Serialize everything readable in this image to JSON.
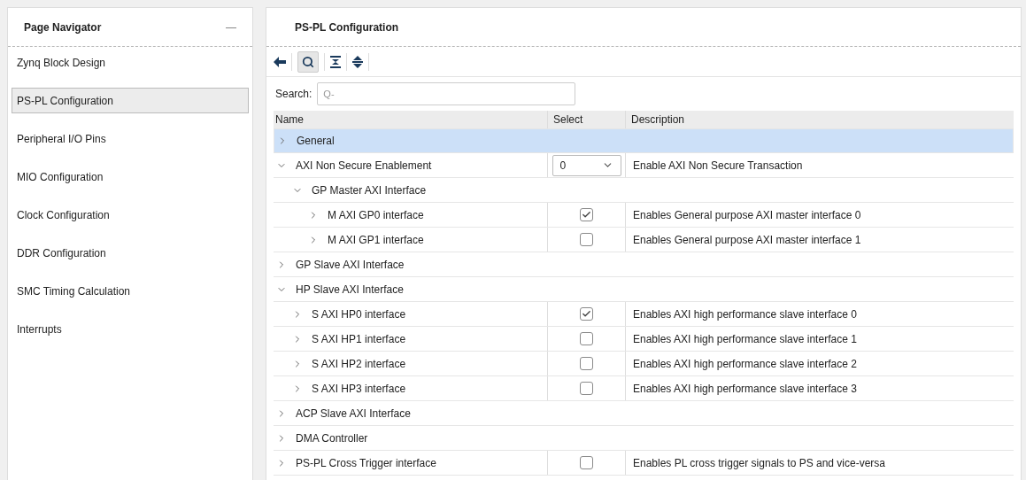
{
  "navigator": {
    "title": "Page Navigator",
    "collapse_symbol": "—",
    "items": [
      {
        "label": "Zynq Block Design",
        "selected": false
      },
      {
        "label": "PS-PL Configuration",
        "selected": true
      },
      {
        "label": "Peripheral I/O Pins",
        "selected": false
      },
      {
        "label": "MIO Configuration",
        "selected": false
      },
      {
        "label": "Clock Configuration",
        "selected": false
      },
      {
        "label": "DDR Configuration",
        "selected": false
      },
      {
        "label": "SMC Timing Calculation",
        "selected": false
      },
      {
        "label": "Interrupts",
        "selected": false
      }
    ]
  },
  "config": {
    "title": "PS-PL Configuration",
    "search": {
      "label": "Search:",
      "placeholder": "Q-"
    },
    "table": {
      "columns": [
        "Name",
        "Select",
        "Description"
      ],
      "rows": [
        {
          "name": "General",
          "kind": "none",
          "expanded": false,
          "selected": true
        },
        {
          "name": "AXI Non Secure Enablement",
          "kind": "dropdown",
          "value": "0",
          "description": "Enable AXI Non Secure Transaction",
          "expanded": true,
          "selected": false,
          "children": [
            {
              "name": "GP Master AXI Interface",
              "kind": "none",
              "expanded": true,
              "selected": false,
              "children": [
                {
                  "name": "M AXI GP0 interface",
                  "kind": "checkbox",
                  "checked": true,
                  "description": "Enables General purpose AXI master interface 0",
                  "expanded": false,
                  "selected": false
                },
                {
                  "name": "M AXI GP1 interface",
                  "kind": "checkbox",
                  "checked": false,
                  "description": "Enables General purpose AXI master interface 1",
                  "expanded": false,
                  "selected": false
                }
              ]
            }
          ]
        },
        {
          "name": "GP Slave AXI Interface",
          "kind": "none",
          "expanded": false,
          "selected": false
        },
        {
          "name": "HP Slave AXI Interface",
          "kind": "none",
          "expanded": true,
          "selected": false,
          "children": [
            {
              "name": "S AXI HP0 interface",
              "kind": "checkbox",
              "checked": true,
              "description": "Enables AXI high performance slave interface 0",
              "expanded": false,
              "selected": false
            },
            {
              "name": "S AXI HP1 interface",
              "kind": "checkbox",
              "checked": false,
              "description": "Enables AXI high performance slave interface 1",
              "expanded": false,
              "selected": false
            },
            {
              "name": "S AXI HP2 interface",
              "kind": "checkbox",
              "checked": false,
              "description": "Enables AXI high performance slave interface 2",
              "expanded": false,
              "selected": false
            },
            {
              "name": "S AXI HP3 interface",
              "kind": "checkbox",
              "checked": false,
              "description": "Enables AXI high performance slave interface 3",
              "expanded": false,
              "selected": false
            }
          ]
        },
        {
          "name": "ACP Slave AXI Interface",
          "kind": "none",
          "expanded": false,
          "selected": false
        },
        {
          "name": "DMA Controller",
          "kind": "none",
          "expanded": false,
          "selected": false
        },
        {
          "name": "PS-PL Cross Trigger interface",
          "kind": "checkbox",
          "checked": false,
          "description": "Enables PL cross trigger signals to PS and vice-versa",
          "expanded": false,
          "selected": false
        }
      ]
    }
  }
}
